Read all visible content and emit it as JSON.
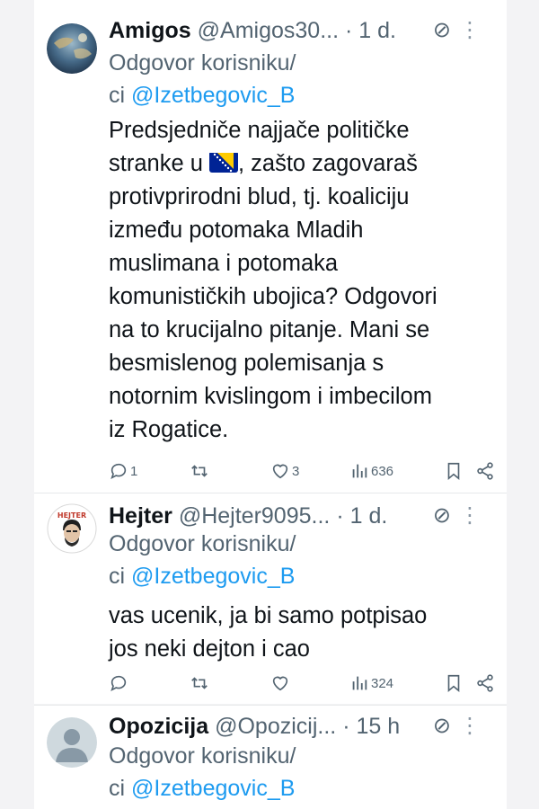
{
  "tweets": [
    {
      "name": "Amigos",
      "handle": "@Amigos30...",
      "dot": "·",
      "time": "1 d.",
      "reply_line1": "Odgovor korisniku/",
      "reply_line2_prefix": "ci ",
      "reply_mention": "@Izetbegovic_B",
      "text_lines": [
        "Predsjedniče najjače političke",
        "stranke u",
        ", zašto zagovaraš",
        "protivprirodni blud, tj. koaliciju",
        "između potomaka Mladih",
        "muslimana i potomaka",
        "komunističkih ubojica? Odgovori",
        "na to krucijalno pitanje. Mani se",
        "besmislenog polemisanja s",
        "notornim kvislingom i imbecilom",
        "iz Rogatice."
      ],
      "replies": "1",
      "retweets": "",
      "likes": "3",
      "views": "636"
    },
    {
      "name": "Hejter",
      "handle": "@Hejter9095...",
      "dot": "·",
      "time": "1 d.",
      "reply_line1": "Odgovor korisniku/",
      "reply_line2_prefix": "ci ",
      "reply_mention": "@Izetbegovic_B",
      "text_lines": [
        "vas ucenik, ja bi samo potpisao",
        "jos neki dejton i cao"
      ],
      "replies": "",
      "retweets": "",
      "likes": "",
      "views": "324",
      "avatar_text": "HEJTER"
    },
    {
      "name": "Opozicija",
      "handle": "@Opozicij...",
      "dot": "·",
      "time": "15 h",
      "reply_line1": "Odgovor korisniku/",
      "reply_line2_prefix": "ci ",
      "reply_mention": "@Izetbegovic_B"
    }
  ],
  "icons": {
    "reply": "reply-icon",
    "retweet": "retweet-icon",
    "like": "heart-icon",
    "views": "views-icon",
    "bookmark": "bookmark-icon",
    "share": "share-icon",
    "no_entry": "no-entry-icon",
    "more": "more-icon",
    "flag": "bosnia-flag-emoji"
  },
  "colors": {
    "mention": "#1d9bf0",
    "secondary": "#536471",
    "primary_text": "#0f1419"
  }
}
